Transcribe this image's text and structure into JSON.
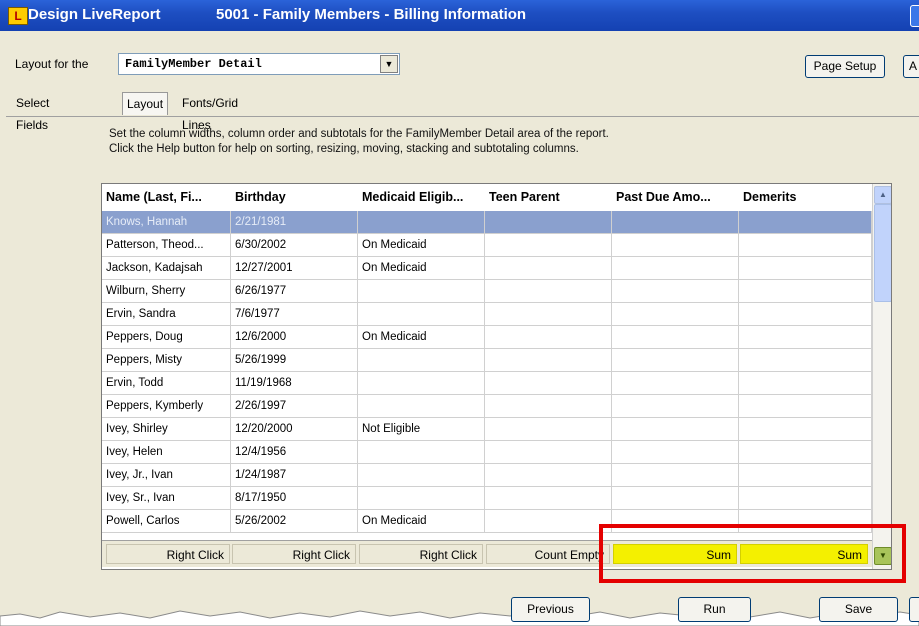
{
  "titlebar": {
    "app_title": "Design LiveReport",
    "doc_title": "5001 - Family Members - Billing Information"
  },
  "layout": {
    "label": "Layout for the",
    "selected": "FamilyMember Detail"
  },
  "buttons": {
    "page_setup": "Page Setup",
    "a_partial": "A",
    "previous": "Previous",
    "run": "Run",
    "save": "Save"
  },
  "tabs": [
    "Select Fields",
    "Layout",
    "Fonts/Grid Lines"
  ],
  "instructions": [
    "Set the column widths, column order and subtotals for the FamilyMember Detail area of the report.",
    "Click the Help button for help on sorting, resizing, moving, stacking and subtotaling columns."
  ],
  "grid": {
    "columns": [
      "Name (Last, Fi...",
      "Birthday",
      "Medicaid Eligib...",
      "Teen Parent",
      "Past Due Amo...",
      "Demerits"
    ],
    "rows": [
      [
        "Knows, Hannah",
        "2/21/1981",
        "",
        "",
        "",
        ""
      ],
      [
        "Patterson, Theod...",
        "6/30/2002",
        "On Medicaid",
        "",
        "",
        ""
      ],
      [
        "Jackson, Kadajsah",
        "12/27/2001",
        "On Medicaid",
        "",
        "",
        ""
      ],
      [
        "Wilburn, Sherry",
        "6/26/1977",
        "",
        "",
        "",
        ""
      ],
      [
        "Ervin, Sandra",
        "7/6/1977",
        "",
        "",
        "",
        ""
      ],
      [
        "Peppers, Doug",
        "12/6/2000",
        "On Medicaid",
        "",
        "",
        ""
      ],
      [
        "Peppers, Misty",
        "5/26/1999",
        "",
        "",
        "",
        ""
      ],
      [
        "Ervin, Todd",
        "11/19/1968",
        "",
        "",
        "",
        ""
      ],
      [
        "Peppers, Kymberly",
        "2/26/1997",
        "",
        "",
        "",
        ""
      ],
      [
        "Ivey, Shirley",
        "12/20/2000",
        "Not Eligible",
        "",
        "",
        ""
      ],
      [
        "Ivey, Helen",
        "12/4/1956",
        "",
        "",
        "",
        ""
      ],
      [
        "Ivey, Jr., Ivan",
        "1/24/1987",
        "",
        "",
        "",
        ""
      ],
      [
        "Ivey, Sr., Ivan",
        "8/17/1950",
        "",
        "",
        "",
        ""
      ],
      [
        "Powell, Carlos",
        "5/26/2002",
        "On Medicaid",
        "",
        "",
        ""
      ]
    ],
    "footer": [
      "Right Click",
      "Right Click",
      "Right Click",
      "Count Empty",
      "Sum",
      "Sum"
    ],
    "selected_row": 0
  },
  "colors": {
    "selection": "#8aa0ce",
    "highlight_box": "#e40000",
    "subtotal_fill": "#f4f000",
    "titlebar": "#1e4fc2"
  }
}
